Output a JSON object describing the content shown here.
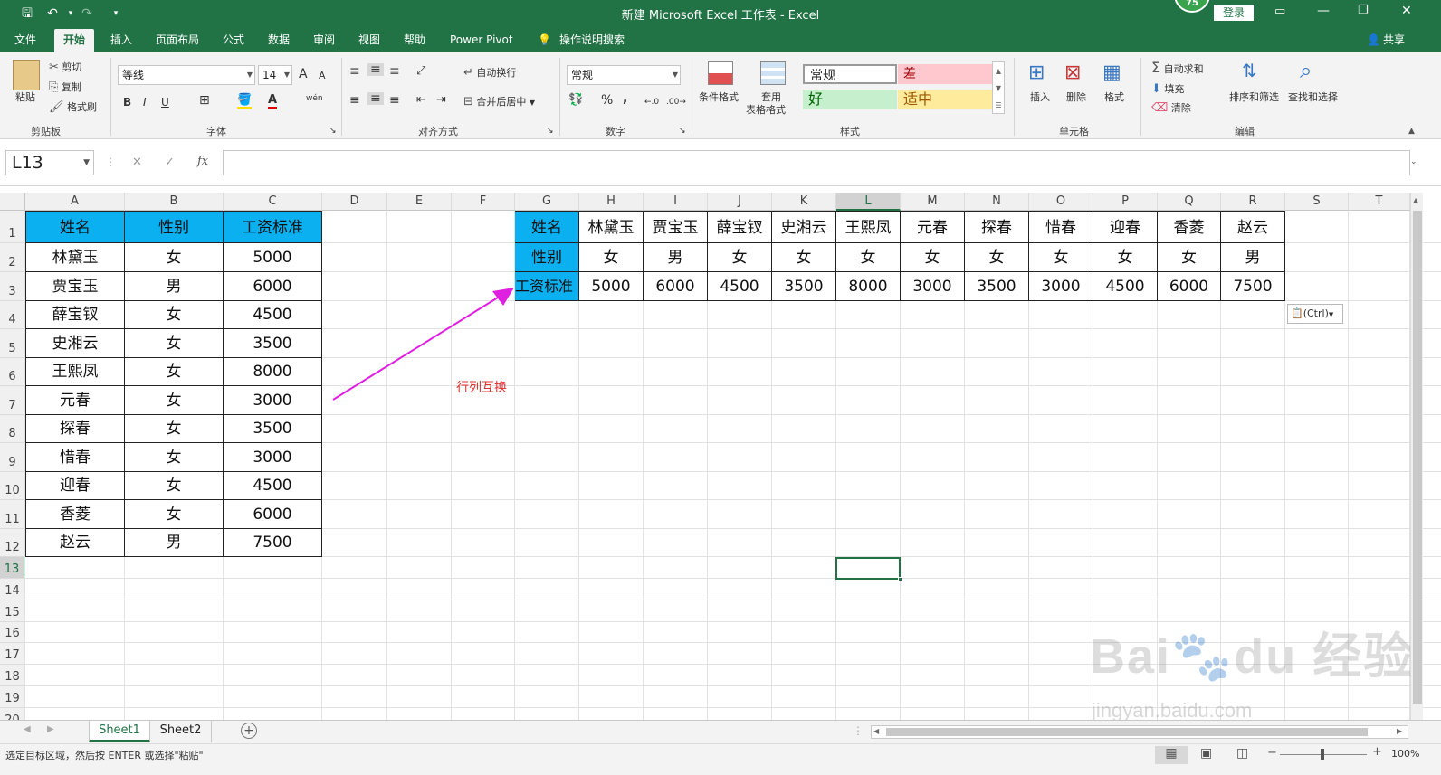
{
  "title_bar": {
    "title": "新建 Microsoft Excel 工作表  -  Excel",
    "save_icon": "save-icon",
    "undo_icon": "undo-icon",
    "redo_icon": "redo-icon",
    "badge": "75",
    "login": "登录"
  },
  "tabs": [
    "文件",
    "开始",
    "插入",
    "页面布局",
    "公式",
    "数据",
    "审阅",
    "视图",
    "帮助",
    "Power Pivot",
    "操作说明搜索"
  ],
  "share_label": "共享",
  "clipboard": {
    "paste": "粘贴",
    "cut": "剪切",
    "copy": "复制",
    "format_painter": "格式刷",
    "label": "剪贴板"
  },
  "font": {
    "name": "等线",
    "size": "14",
    "grow": "A",
    "shrink": "A",
    "bold": "B",
    "italic": "I",
    "underline": "U",
    "font_color": "A",
    "wen": "wén",
    "label": "字体"
  },
  "alignment": {
    "wrap": "自动换行",
    "merge": "合并后居中",
    "label": "对齐方式"
  },
  "number": {
    "format": "常规",
    "percent": "%",
    "comma": ",",
    "label": "数字"
  },
  "styles": {
    "conditional": "条件格式",
    "table_format_1": "套用",
    "table_format_2": "表格格式",
    "normal": "常规",
    "bad": "差",
    "good": "好",
    "neutral": "适中",
    "label": "样式"
  },
  "cells_group": {
    "insert": "插入",
    "delete": "删除",
    "format": "格式",
    "label": "单元格"
  },
  "editing": {
    "autosum": "自动求和",
    "fill": "填充",
    "clear": "清除",
    "sort": "排序和筛选",
    "find": "查找和选择",
    "label": "编辑"
  },
  "formula_bar": {
    "name_box": "L13",
    "cancel": "✕",
    "enter": "✓",
    "fx": "fx",
    "formula": ""
  },
  "columns": [
    "A",
    "B",
    "C",
    "D",
    "E",
    "F",
    "G",
    "H",
    "I",
    "J",
    "K",
    "L",
    "M",
    "N",
    "O",
    "P",
    "Q",
    "R",
    "S",
    "T"
  ],
  "rows": [
    "1",
    "2",
    "3",
    "4",
    "5",
    "6",
    "7",
    "8",
    "9",
    "10",
    "11",
    "12",
    "13",
    "14",
    "15",
    "16",
    "17",
    "18",
    "19",
    "20"
  ],
  "source_table": {
    "headers": [
      "姓名",
      "性别",
      "工资标准"
    ],
    "rows": [
      [
        "林黛玉",
        "女",
        "5000"
      ],
      [
        "贾宝玉",
        "男",
        "6000"
      ],
      [
        "薛宝钗",
        "女",
        "4500"
      ],
      [
        "史湘云",
        "女",
        "3500"
      ],
      [
        "王熙凤",
        "女",
        "8000"
      ],
      [
        "元春",
        "女",
        "3000"
      ],
      [
        "探春",
        "女",
        "3500"
      ],
      [
        "惜春",
        "女",
        "3000"
      ],
      [
        "迎春",
        "女",
        "4500"
      ],
      [
        "香菱",
        "女",
        "6000"
      ],
      [
        "赵云",
        "男",
        "7500"
      ]
    ]
  },
  "transposed_table": {
    "row_headers": [
      "姓名",
      "性别",
      "工资标准"
    ],
    "names": [
      "林黛玉",
      "贾宝玉",
      "薛宝钗",
      "史湘云",
      "王熙凤",
      "元春",
      "探春",
      "惜春",
      "迎春",
      "香菱",
      "赵云"
    ],
    "genders": [
      "女",
      "男",
      "女",
      "女",
      "女",
      "女",
      "女",
      "女",
      "女",
      "女",
      "男"
    ],
    "salaries": [
      "5000",
      "6000",
      "4500",
      "3500",
      "8000",
      "3000",
      "3500",
      "3000",
      "4500",
      "6000",
      "7500"
    ]
  },
  "annotation": "行列互换",
  "paste_options": "(Ctrl)",
  "sheets": [
    "Sheet1",
    "Sheet2"
  ],
  "status_text": "选定目标区域，然后按 ENTER 或选择\"粘贴\"",
  "zoom": "100%",
  "colors": {
    "excel_green": "#217346",
    "header_fill": "#0ab0f0",
    "arrow": "#e020e0",
    "annotation": "#e03030"
  }
}
